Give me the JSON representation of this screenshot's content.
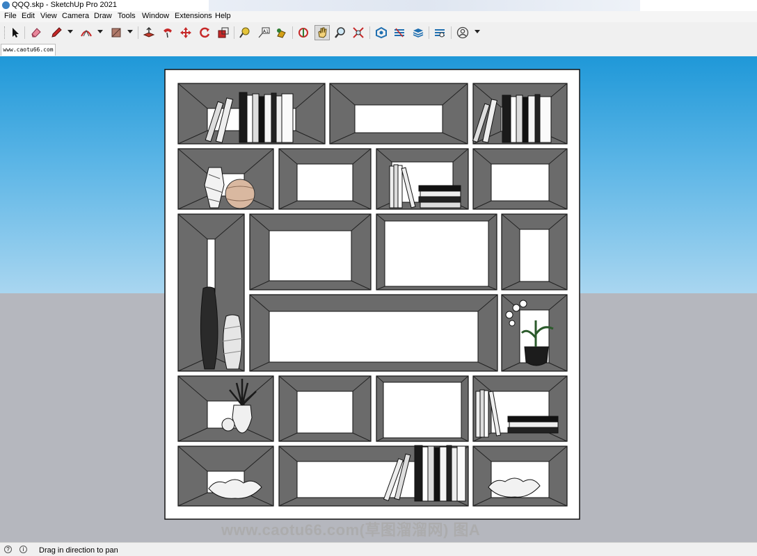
{
  "window": {
    "title": "QQQ.skp - SketchUp Pro 2021"
  },
  "menu": {
    "items": [
      "File",
      "Edit",
      "View",
      "Camera",
      "Draw",
      "Tools",
      "Window",
      "Extensions",
      "Help"
    ]
  },
  "toolbar": {
    "tools": [
      "select-icon",
      "eraser-icon",
      "pencil-icon",
      "arc-icon",
      "paint-bucket-icon",
      "push-pull-icon",
      "follow-me-icon",
      "move-icon",
      "rotate-icon",
      "scale-icon",
      "tape-measure-icon",
      "text-label-icon",
      "paint-icon",
      "orbit-icon",
      "pan-icon",
      "zoom-icon",
      "zoom-extents-icon",
      "warehouse-icon",
      "extension-icon",
      "layers-icon",
      "sandbox-icon",
      "account-icon"
    ],
    "active_tool": "pan-icon"
  },
  "tabs": [
    {
      "label": "www.caotu66.com"
    }
  ],
  "viewport": {
    "model": "bookshelf",
    "watermark": "www.caotu66.com(草图溜溜网) 图A",
    "colors": {
      "sky": "#1f98d8",
      "ground": "#b5b7be",
      "shelf_inner": "#6b6b6b",
      "shelf_frame": "#ffffff"
    }
  },
  "status": {
    "hint": "Drag in direction to pan"
  }
}
